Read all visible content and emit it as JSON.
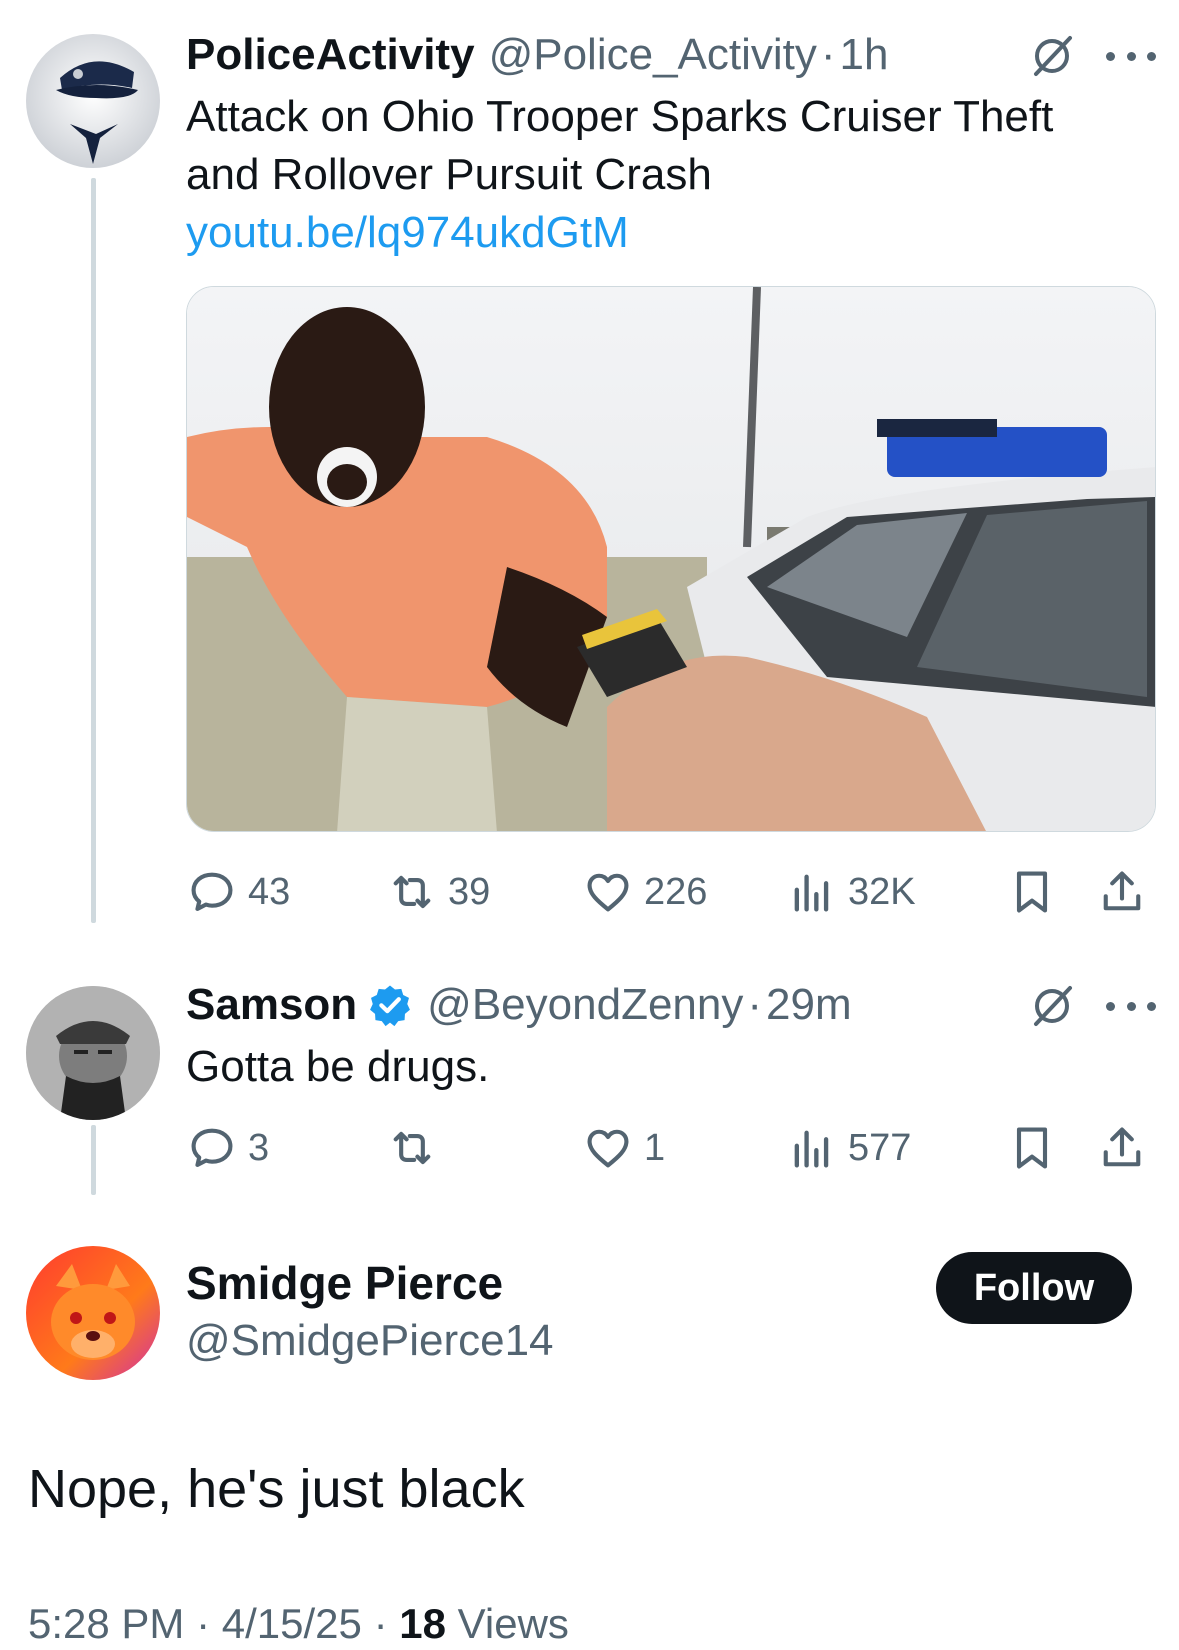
{
  "tweet1": {
    "name": "PoliceActivity",
    "handle": "@Police_Activity",
    "sep": "·",
    "time": "1h",
    "text_line1": "Attack on Ohio Trooper Sparks Cruiser Theft",
    "text_line2": "and Rollover Pursuit Crash",
    "link": "youtu.be/lq974ukdGtM",
    "replies": "43",
    "reposts": "39",
    "likes": "226",
    "views": "32K"
  },
  "tweet2": {
    "name": "Samson",
    "handle": "@BeyondZenny",
    "sep": "·",
    "time": "29m",
    "text": "Gotta be drugs.",
    "replies": "3",
    "reposts": "",
    "likes": "1",
    "views": "577"
  },
  "main": {
    "name": "Smidge Pierce",
    "handle": "@SmidgePierce14",
    "follow_label": "Follow",
    "text": "Nope, he's just black",
    "time": "5:28 PM",
    "sep": "·",
    "date": "4/15/25",
    "views_count": "18",
    "views_label": "Views"
  },
  "icons": {
    "reply": "reply-icon",
    "repost": "repost-icon",
    "like": "like-icon",
    "views": "views-icon",
    "bookmark": "bookmark-icon",
    "share": "share-icon",
    "grok": "grok-icon",
    "more": "more-icon",
    "verified": "verified-badge-icon"
  },
  "colors": {
    "link": "#1d9bf0",
    "secondary": "#536471",
    "primary": "#0f1419",
    "verified": "#1d9bf0"
  }
}
